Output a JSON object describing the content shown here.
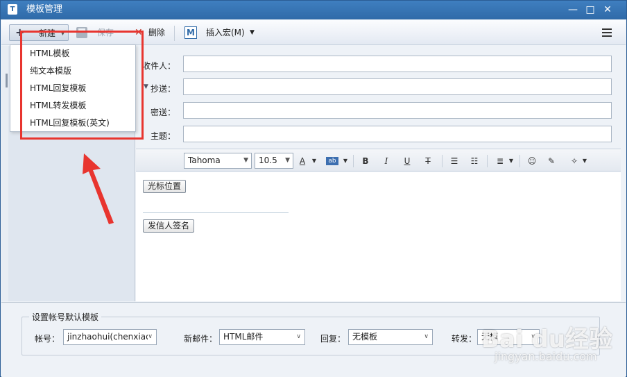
{
  "window": {
    "title": "模板管理"
  },
  "titlebar_buttons": {
    "minimize": "—",
    "maximize": "□",
    "close": "✕"
  },
  "toolbar": {
    "new_label": "新建",
    "save_label": "保存",
    "delete_label": "删除",
    "macro_icon": "M",
    "macro_label": "插入宏(M)"
  },
  "new_menu": {
    "items": [
      "HTML模板",
      "纯文本模版",
      "HTML回复模板",
      "HTML转发模板",
      "HTML回复模板(英文)"
    ]
  },
  "compose": {
    "to_label": "收件人：",
    "cc_label": "抄送：",
    "bcc_label": "密送：",
    "subject_label": "主题："
  },
  "format": {
    "font": "Tahoma",
    "size": "10.5",
    "font_color": "A",
    "bg_color": "ab",
    "bold": "B",
    "italic": "I",
    "underline": "U",
    "strike": "T"
  },
  "editor": {
    "cursor_button": "光标位置",
    "signature_button": "发信人签名"
  },
  "defaults": {
    "group_title": "设置帐号默认模板",
    "account_label": "帐号：",
    "account_value": "jinzhaohui(chenxiao",
    "new_mail_label": "新邮件：",
    "new_mail_value": "HTML邮件",
    "reply_label": "回复：",
    "reply_value": "无模板",
    "forward_label": "转发：",
    "forward_value": "无模"
  },
  "watermark": {
    "brand": "Bai du经验",
    "url": "jingyan.baidu.com"
  },
  "colors": {
    "accent": "#2f6aa8",
    "annotation": "#e8352f"
  }
}
